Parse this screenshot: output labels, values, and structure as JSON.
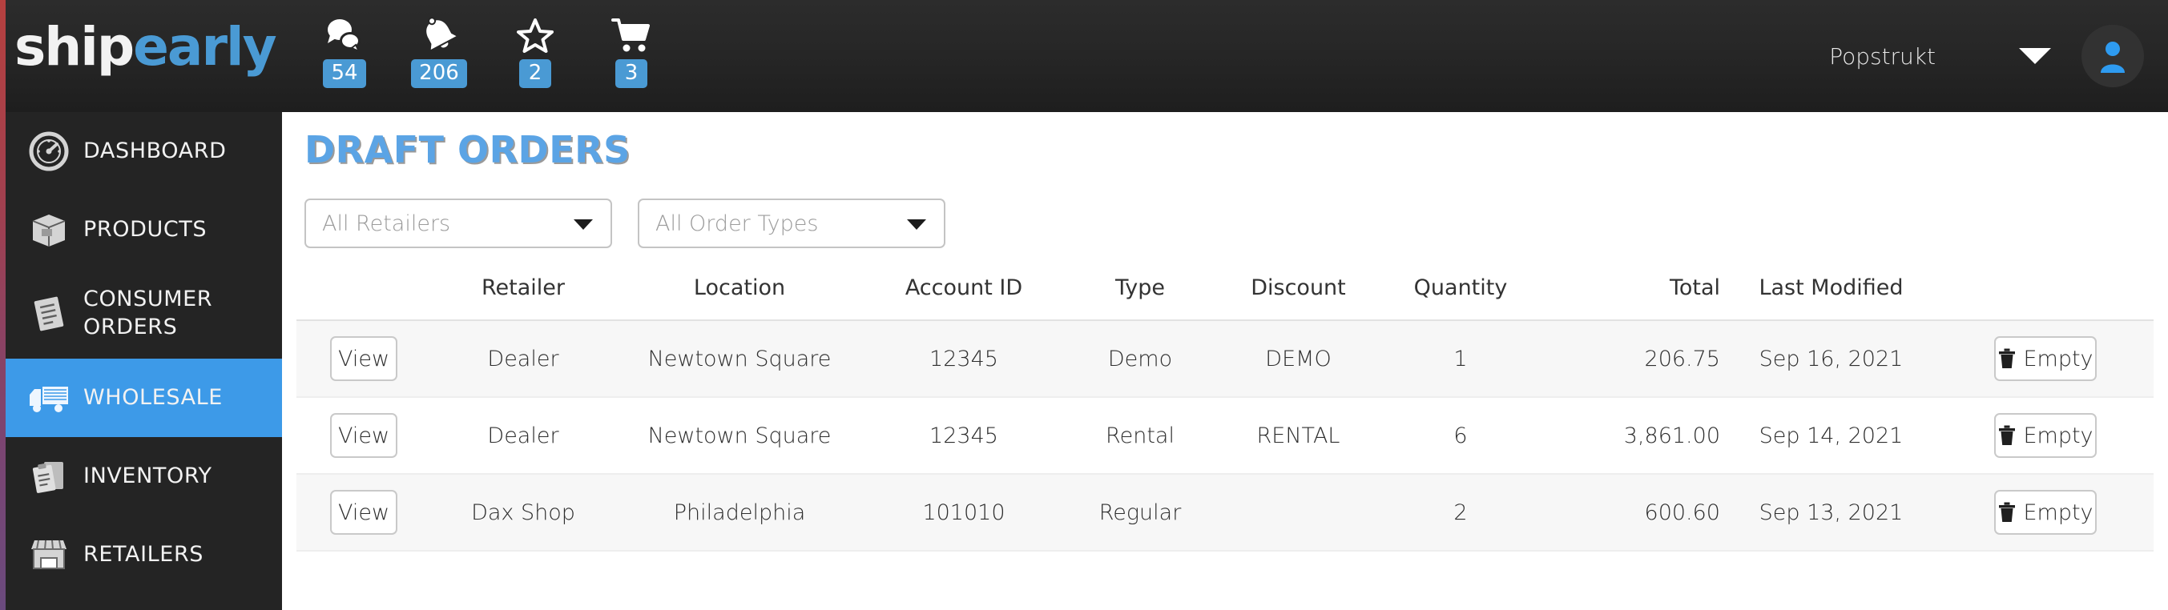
{
  "brand": {
    "part1": "ship",
    "part2": "early",
    "accent_color": "#4a9ad4"
  },
  "topbar": {
    "nav_icons": [
      {
        "name": "messages-icon",
        "icon": "chat-bubbles",
        "badge": "54"
      },
      {
        "name": "notifications-icon",
        "icon": "bell",
        "badge": "206"
      },
      {
        "name": "favorites-icon",
        "icon": "star",
        "badge": "2"
      },
      {
        "name": "cart-icon",
        "icon": "shopping-cart",
        "badge": "3"
      }
    ],
    "user_name": "Popstrukt",
    "caret": "chevron-down-icon",
    "avatar": "user-avatar-icon"
  },
  "sidebar": {
    "items": [
      {
        "label": "DASHBOARD",
        "icon": "speedometer-icon",
        "active": false
      },
      {
        "label": "PRODUCTS",
        "icon": "box-icon",
        "active": false
      },
      {
        "label": "CONSUMER ORDERS",
        "icon": "document-icon",
        "active": false
      },
      {
        "label": "WHOLESALE",
        "icon": "truck-icon",
        "active": true
      },
      {
        "label": "INVENTORY",
        "icon": "clipboard-icon",
        "active": false
      },
      {
        "label": "RETAILERS",
        "icon": "storefront-icon",
        "active": false
      }
    ]
  },
  "main": {
    "page_title": "DRAFT ORDERS",
    "filters": [
      {
        "name": "retailer-filter",
        "value": "All Retailers"
      },
      {
        "name": "order-type-filter",
        "value": "All Order Types"
      }
    ],
    "table": {
      "columns": [
        "",
        "Retailer",
        "Location",
        "Account ID",
        "Type",
        "Discount",
        "Quantity",
        "Total",
        "Last Modified",
        ""
      ],
      "view_label": "View",
      "empty_label": "Empty",
      "rows": [
        {
          "retailer": "Dealer",
          "location": "Newtown Square",
          "account_id": "12345",
          "type": "Demo",
          "discount": "DEMO",
          "quantity": "1",
          "total": "206.75",
          "last_modified": "Sep 16, 2021"
        },
        {
          "retailer": "Dealer",
          "location": "Newtown Square",
          "account_id": "12345",
          "type": "Rental",
          "discount": "RENTAL",
          "quantity": "6",
          "total": "3,861.00",
          "last_modified": "Sep 14, 2021"
        },
        {
          "retailer": "Dax Shop",
          "location": "Philadelphia",
          "account_id": "101010",
          "type": "Regular",
          "discount": "",
          "quantity": "2",
          "total": "600.60",
          "last_modified": "Sep 13, 2021"
        }
      ]
    }
  }
}
